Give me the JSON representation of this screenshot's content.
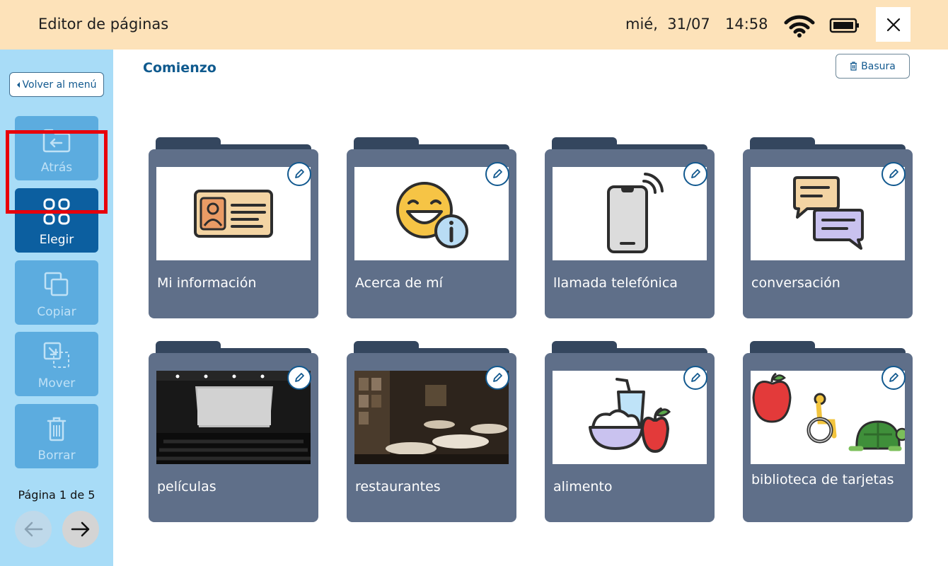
{
  "topbar": {
    "title": "Editor de páginas",
    "date": "mié,  31/07",
    "time": "14:58",
    "icons": [
      "wifi-icon",
      "battery-icon",
      "close-icon"
    ]
  },
  "sidebar": {
    "back_label": "Volver al menú",
    "buttons": [
      {
        "label": "Atrás",
        "icon": "folder-back-icon",
        "active": false
      },
      {
        "label": "Elegir",
        "icon": "grid-select-icon",
        "active": true
      },
      {
        "label": "Copiar",
        "icon": "copy-icon",
        "active": false
      },
      {
        "label": "Mover",
        "icon": "move-icon",
        "active": false
      },
      {
        "label": "Borrar",
        "icon": "trash-icon",
        "active": false
      }
    ],
    "page_info": "Página 1 de 5"
  },
  "main": {
    "breadcrumb": "Comienzo",
    "trash_label": "Basura",
    "folders": [
      {
        "label": "Mi información",
        "image": "id-card-icon"
      },
      {
        "label": "Acerca de mí",
        "image": "smiley-info-icon"
      },
      {
        "label": "llamada telefónica",
        "image": "phone-call-icon"
      },
      {
        "label": "conversación",
        "image": "speech-bubbles-icon"
      },
      {
        "label": "películas",
        "image": "cinema-photo"
      },
      {
        "label": "restaurantes",
        "image": "restaurant-photo"
      },
      {
        "label": "alimento",
        "image": "food-icon"
      },
      {
        "label": "biblioteca de tarjetas",
        "image": "card-library-icon"
      }
    ]
  },
  "colors": {
    "topbar_bg": "#fde2b9",
    "sidebar_bg": "#a8dcf7",
    "active_button": "#0c5fa0",
    "folder_body": "#5f6f89",
    "folder_tab": "#34465e",
    "highlight": "#e8000b"
  }
}
